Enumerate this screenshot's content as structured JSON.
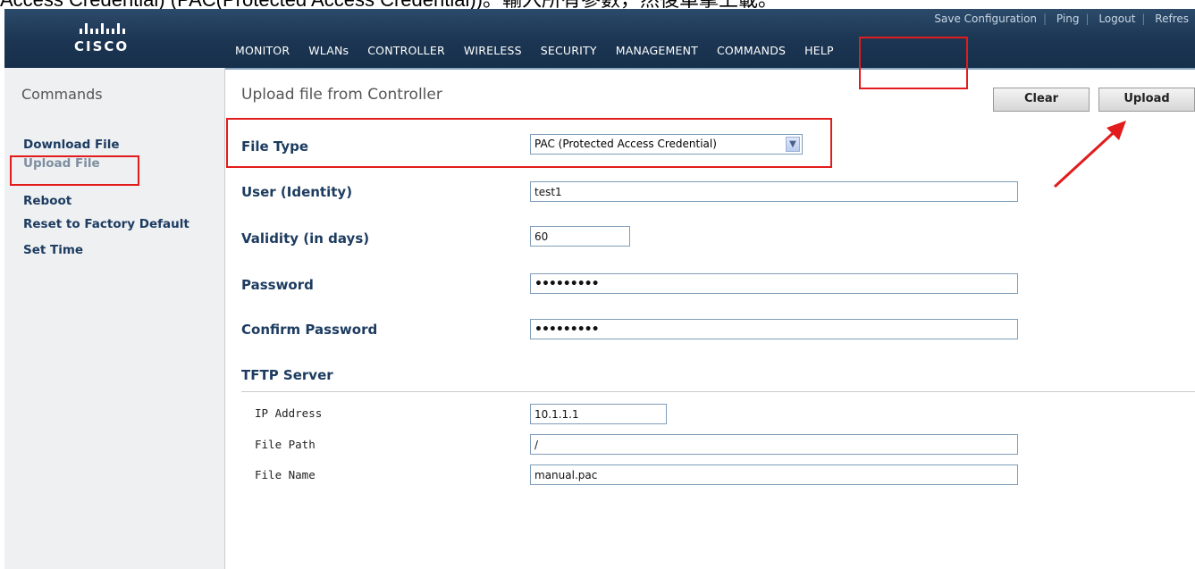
{
  "caption": "Access Credential) (PAC(Protected Access Credential))。輸入所有參數，然後單擊上載。",
  "brand": {
    "wordmark": "CISCO",
    "icon": "cisco-bridge-logo"
  },
  "util_links": [
    "Save Configuration",
    "Ping",
    "Logout",
    "Refres"
  ],
  "nav": [
    "MONITOR",
    "WLANs",
    "CONTROLLER",
    "WIRELESS",
    "SECURITY",
    "MANAGEMENT",
    "COMMANDS",
    "HELP"
  ],
  "sidebar": {
    "title": "Commands",
    "items": [
      "Download File",
      "Upload File",
      "Reboot",
      "Reset to Factory Default",
      "Set Time"
    ],
    "active": "Upload File"
  },
  "main": {
    "title": "Upload file from Controller",
    "buttons": {
      "clear": "Clear",
      "upload": "Upload"
    },
    "file_type": {
      "label": "File Type",
      "value": "PAC (Protected Access Credential)"
    },
    "user": {
      "label": "User (Identity)",
      "value": "test1"
    },
    "validity": {
      "label": "Validity (in days)",
      "value": "60"
    },
    "password": {
      "label": "Password",
      "value": "•••••••••"
    },
    "confirm": {
      "label": "Confirm Password",
      "value": "•••••••••"
    },
    "tftp": {
      "heading": "TFTP Server",
      "ip": {
        "label": "IP Address",
        "value": "10.1.1.1"
      },
      "path": {
        "label": "File Path",
        "value": "/"
      },
      "name": {
        "label": "File Name",
        "value": "manual.pac"
      }
    }
  },
  "colors": {
    "header": "#1b3552",
    "annotation": "#e21c1c",
    "label": "#1d3c60"
  }
}
